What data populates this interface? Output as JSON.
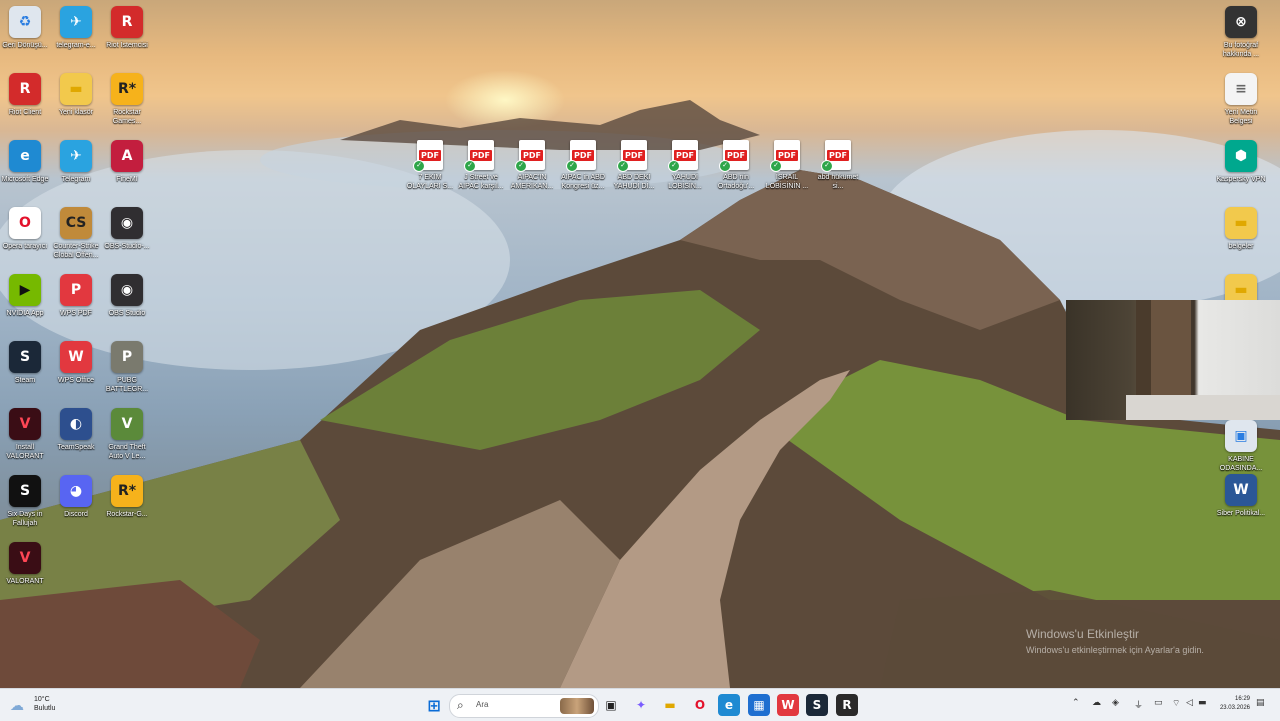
{
  "desktop": {
    "left_icons": [
      {
        "label": "Geri Dönüşü...",
        "glyph": "♻",
        "color": "#dfe6ee",
        "fg": "#2a7de1"
      },
      {
        "label": "telegram-e...",
        "glyph": "✈",
        "color": "#2aa3e0",
        "fg": "#ffffff"
      },
      {
        "label": "Riot İstemcisi",
        "glyph": "R",
        "color": "#d32b2b",
        "fg": "#ffffff"
      },
      {
        "label": "Riot Client",
        "glyph": "R",
        "color": "#d32b2b",
        "fg": "#ffffff"
      },
      {
        "label": "Yeni klasör",
        "glyph": "▬",
        "color": "#f2c94c",
        "fg": "#e0a800"
      },
      {
        "label": "Rockstar Games...",
        "glyph": "R*",
        "color": "#f6b21b",
        "fg": "#222222"
      },
      {
        "label": "Microsoft Edge",
        "glyph": "e",
        "color": "#1f8ad2",
        "fg": "#ffffff"
      },
      {
        "label": "Telegram",
        "glyph": "✈",
        "color": "#2aa3e0",
        "fg": "#ffffff"
      },
      {
        "label": "FineMI",
        "glyph": "A",
        "color": "#c31e3e",
        "fg": "#ffffff"
      },
      {
        "label": "Opera tarayıcı",
        "glyph": "O",
        "color": "#ffffff",
        "fg": "#e3122c"
      },
      {
        "label": "Counter-Strike Global Offen...",
        "glyph": "CS",
        "color": "#c08a3a",
        "fg": "#222222"
      },
      {
        "label": "OBS-Studio-...",
        "glyph": "◉",
        "color": "#302e31",
        "fg": "#ffffff"
      },
      {
        "label": "NVIDIA App",
        "glyph": "▶",
        "color": "#76b900",
        "fg": "#111111"
      },
      {
        "label": "WPS PDF",
        "glyph": "P",
        "color": "#e2383f",
        "fg": "#ffffff"
      },
      {
        "label": "OBS Studio",
        "glyph": "◉",
        "color": "#302e31",
        "fg": "#ffffff"
      },
      {
        "label": "Steam",
        "glyph": "S",
        "color": "#1b2838",
        "fg": "#ffffff"
      },
      {
        "label": "WPS Office",
        "glyph": "W",
        "color": "#e2383f",
        "fg": "#ffffff"
      },
      {
        "label": "PUBG BATTLEGR...",
        "glyph": "P",
        "color": "#7a7a6e",
        "fg": "#ffffff"
      },
      {
        "label": "Install VALORANT",
        "glyph": "V",
        "color": "#3a0d15",
        "fg": "#ff4655"
      },
      {
        "label": "TeamSpeak",
        "glyph": "◐",
        "color": "#2d4f8e",
        "fg": "#ffffff"
      },
      {
        "label": "Grand Theft Auto V Le...",
        "glyph": "V",
        "color": "#5b8a3a",
        "fg": "#ffffff"
      },
      {
        "label": "Six Days in Fallujah",
        "glyph": "S",
        "color": "#111111",
        "fg": "#ffffff"
      },
      {
        "label": "Discord",
        "glyph": "◕",
        "color": "#5865f2",
        "fg": "#ffffff"
      },
      {
        "label": "Rockstar-G...",
        "glyph": "R*",
        "color": "#f6b21b",
        "fg": "#222222"
      },
      {
        "label": "VALORANT",
        "glyph": "V",
        "color": "#3a0d15",
        "fg": "#ff4655"
      }
    ],
    "pdf_icons": [
      {
        "label": "7 EKİM OLAYLARI S..."
      },
      {
        "label": "J Street ve AIPAC karşıl..."
      },
      {
        "label": "AIPAC'IN AMERİKAN..."
      },
      {
        "label": "AIPAC in ABD Kongresi üz..."
      },
      {
        "label": "ABD DEKİ YAHUDİ Dİ..."
      },
      {
        "label": "YAHUDİ LOBİSİN..."
      },
      {
        "label": "ABD nin Ortadoğu'..."
      },
      {
        "label": "İSRAİL LOBİSİNİN ..."
      },
      {
        "label": "abd hükümet si..."
      }
    ],
    "pdf_tag": "PDF",
    "right_icons": [
      {
        "label": "Bu fotoğraf hakkında ...",
        "glyph": "⊗",
        "color": "#333333",
        "fg": "#ffffff"
      },
      {
        "label": "Yeni Metin Belgesi",
        "glyph": "≡",
        "color": "#f4f4f4",
        "fg": "#666666"
      },
      {
        "label": "Kaspersky VPN",
        "glyph": "⬢",
        "color": "#00a88e",
        "fg": "#ffffff"
      },
      {
        "label": "belgeler",
        "glyph": "▬",
        "color": "#f2c94c",
        "fg": "#e0a800"
      },
      {
        "label": "",
        "glyph": "▬",
        "color": "#f2c94c",
        "fg": "#e0a800"
      },
      {
        "label": "KABİNE ODASINDA...",
        "glyph": "▣",
        "color": "#dfe6ee",
        "fg": "#2a7de1"
      },
      {
        "label": "Siber Politikal...",
        "glyph": "W",
        "color": "#2b5797",
        "fg": "#ffffff"
      }
    ],
    "watermark": {
      "title": "Windows'u Etkinleştir",
      "subtitle": "Windows'u etkinleştirmek için Ayarlar'a gidin."
    }
  },
  "taskbar": {
    "weather": {
      "temp": "10°C",
      "condition": "Bulutlu"
    },
    "search_placeholder": "Ara",
    "apps": [
      {
        "name": "start",
        "glyph": "⊞",
        "color": "#eef1f5",
        "fg": "#0a6cd6"
      },
      {
        "name": "task-view",
        "glyph": "▣",
        "color": "#eef1f5",
        "fg": "#222222"
      },
      {
        "name": "copilot",
        "glyph": "✦",
        "color": "#eef1f5",
        "fg": "#7a5cff"
      },
      {
        "name": "file-explorer",
        "glyph": "▬",
        "color": "#eef1f5",
        "fg": "#e0a800"
      },
      {
        "name": "opera",
        "glyph": "O",
        "color": "#eef1f5",
        "fg": "#e3122c"
      },
      {
        "name": "edge",
        "glyph": "e",
        "color": "#1f8ad2",
        "fg": "#ffffff"
      },
      {
        "name": "store",
        "glyph": "▦",
        "color": "#1f6fd0",
        "fg": "#ffffff"
      },
      {
        "name": "wps-office",
        "glyph": "W",
        "color": "#e2383f",
        "fg": "#ffffff"
      },
      {
        "name": "steam",
        "glyph": "S",
        "color": "#1b2838",
        "fg": "#ffffff"
      },
      {
        "name": "riot",
        "glyph": "R",
        "color": "#2a2a2a",
        "fg": "#ffffff"
      }
    ],
    "tray": {
      "time": "16:29",
      "date": "23.03.2026"
    }
  }
}
